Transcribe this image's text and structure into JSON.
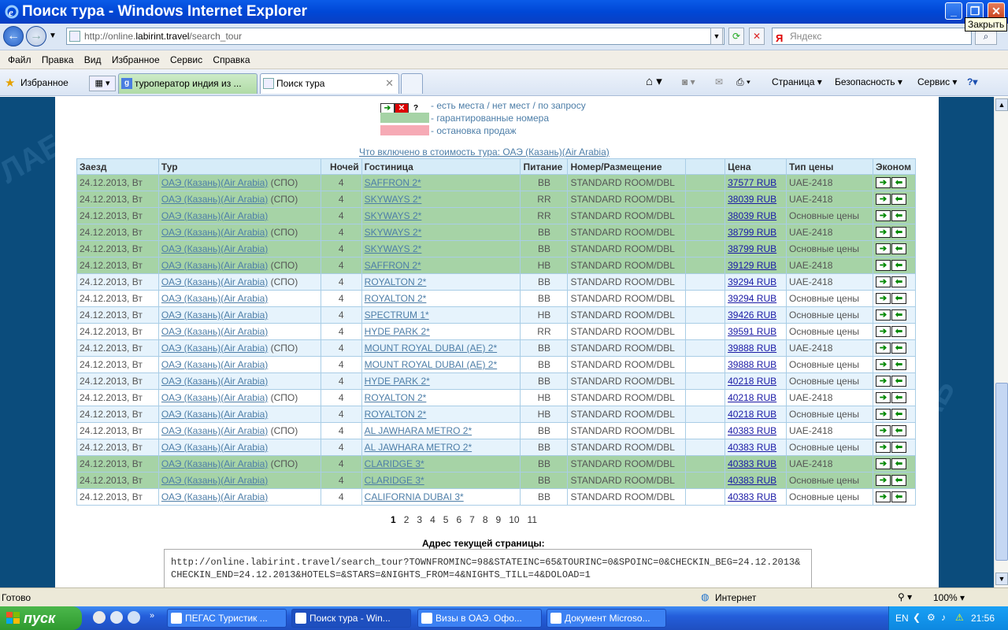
{
  "window": {
    "title": "Поиск тура - Windows Internet Explorer",
    "close_tooltip": "Закрыть",
    "min_label": "_",
    "max_label": "❐",
    "close_label": "✕"
  },
  "address": {
    "prefix": "http://online.",
    "host": "labirint.travel",
    "path": "/search_tour",
    "search_placeholder": "Яндекс",
    "search_engine_glyph": "Я"
  },
  "menu": [
    "Файл",
    "Правка",
    "Вид",
    "Избранное",
    "Сервис",
    "Справка"
  ],
  "favorites_label": "Избранное",
  "tabs": [
    {
      "label": "туроператор индия из ...",
      "active": false
    },
    {
      "label": "Поиск тура",
      "active": true
    }
  ],
  "toolbar": {
    "page": "Страница ▾",
    "security": "Безопасность ▾",
    "service": "Сервис ▾",
    "help": "?▾"
  },
  "legend": {
    "availability": "- есть места / нет мест / по запросу",
    "guaranteed": "- гарантированные номера",
    "stop_sale": "- остановка продаж"
  },
  "included_link": "Что включено в стоимость тура: ОАЭ (Казань)(Air Arabia)",
  "table": {
    "headers": [
      "Заезд",
      "Тур",
      "Ночей",
      "Гостиница",
      "Питание",
      "Номер/Размещение",
      "",
      "Цена",
      "Тип цены",
      "Эконом"
    ],
    "rows": [
      {
        "style": "green",
        "date": "24.12.2013, Вт",
        "tour": "ОАЭ (Казань)(Air Arabia)",
        "spo": "(СПО)",
        "nights": "4",
        "hotel": "SAFFRON 2*",
        "meal": "BB",
        "room": "STANDARD ROOM/DBL",
        "price": "37577 RUB",
        "price_type": "UAE-2418"
      },
      {
        "style": "green",
        "date": "24.12.2013, Вт",
        "tour": "ОАЭ (Казань)(Air Arabia)",
        "spo": "(СПО)",
        "nights": "4",
        "hotel": "SKYWAYS 2*",
        "meal": "RR",
        "room": "STANDARD ROOM/DBL",
        "price": "38039 RUB",
        "price_type": "UAE-2418"
      },
      {
        "style": "green",
        "date": "24.12.2013, Вт",
        "tour": "ОАЭ (Казань)(Air Arabia)",
        "spo": "",
        "nights": "4",
        "hotel": "SKYWAYS 2*",
        "meal": "RR",
        "room": "STANDARD ROOM/DBL",
        "price": "38039 RUB",
        "price_type": "Основные цены"
      },
      {
        "style": "green",
        "date": "24.12.2013, Вт",
        "tour": "ОАЭ (Казань)(Air Arabia)",
        "spo": "(СПО)",
        "nights": "4",
        "hotel": "SKYWAYS 2*",
        "meal": "BB",
        "room": "STANDARD ROOM/DBL",
        "price": "38799 RUB",
        "price_type": "UAE-2418"
      },
      {
        "style": "green",
        "date": "24.12.2013, Вт",
        "tour": "ОАЭ (Казань)(Air Arabia)",
        "spo": "",
        "nights": "4",
        "hotel": "SKYWAYS 2*",
        "meal": "BB",
        "room": "STANDARD ROOM/DBL",
        "price": "38799 RUB",
        "price_type": "Основные цены"
      },
      {
        "style": "green",
        "date": "24.12.2013, Вт",
        "tour": "ОАЭ (Казань)(Air Arabia)",
        "spo": "(СПО)",
        "nights": "4",
        "hotel": "SAFFRON 2*",
        "meal": "HB",
        "room": "STANDARD ROOM/DBL",
        "price": "39129 RUB",
        "price_type": "UAE-2418"
      },
      {
        "style": "blue",
        "date": "24.12.2013, Вт",
        "tour": "ОАЭ (Казань)(Air Arabia)",
        "spo": "(СПО)",
        "nights": "4",
        "hotel": "ROYALTON 2*",
        "meal": "BB",
        "room": "STANDARD ROOM/DBL",
        "price": "39294 RUB",
        "price_type": "UAE-2418"
      },
      {
        "style": "white",
        "date": "24.12.2013, Вт",
        "tour": "ОАЭ (Казань)(Air Arabia)",
        "spo": "",
        "nights": "4",
        "hotel": "ROYALTON 2*",
        "meal": "BB",
        "room": "STANDARD ROOM/DBL",
        "price": "39294 RUB",
        "price_type": "Основные цены"
      },
      {
        "style": "blue",
        "date": "24.12.2013, Вт",
        "tour": "ОАЭ (Казань)(Air Arabia)",
        "spo": "",
        "nights": "4",
        "hotel": "SPECTRUM 1*",
        "meal": "HB",
        "room": "STANDARD ROOM/DBL",
        "price": "39426 RUB",
        "price_type": "Основные цены"
      },
      {
        "style": "white",
        "date": "24.12.2013, Вт",
        "tour": "ОАЭ (Казань)(Air Arabia)",
        "spo": "",
        "nights": "4",
        "hotel": "HYDE PARK 2*",
        "meal": "RR",
        "room": "STANDARD ROOM/DBL",
        "price": "39591 RUB",
        "price_type": "Основные цены"
      },
      {
        "style": "blue",
        "date": "24.12.2013, Вт",
        "tour": "ОАЭ (Казань)(Air Arabia)",
        "spo": "(СПО)",
        "nights": "4",
        "hotel": "MOUNT ROYAL DUBAI (AE) 2*",
        "meal": "BB",
        "room": "STANDARD ROOM/DBL",
        "price": "39888 RUB",
        "price_type": "UAE-2418"
      },
      {
        "style": "white",
        "date": "24.12.2013, Вт",
        "tour": "ОАЭ (Казань)(Air Arabia)",
        "spo": "",
        "nights": "4",
        "hotel": "MOUNT ROYAL DUBAI (AE) 2*",
        "meal": "BB",
        "room": "STANDARD ROOM/DBL",
        "price": "39888 RUB",
        "price_type": "Основные цены"
      },
      {
        "style": "blue",
        "date": "24.12.2013, Вт",
        "tour": "ОАЭ (Казань)(Air Arabia)",
        "spo": "",
        "nights": "4",
        "hotel": "HYDE PARK 2*",
        "meal": "BB",
        "room": "STANDARD ROOM/DBL",
        "price": "40218 RUB",
        "price_type": "Основные цены"
      },
      {
        "style": "white",
        "date": "24.12.2013, Вт",
        "tour": "ОАЭ (Казань)(Air Arabia)",
        "spo": "(СПО)",
        "nights": "4",
        "hotel": "ROYALTON 2*",
        "meal": "HB",
        "room": "STANDARD ROOM/DBL",
        "price": "40218 RUB",
        "price_type": "UAE-2418"
      },
      {
        "style": "blue",
        "date": "24.12.2013, Вт",
        "tour": "ОАЭ (Казань)(Air Arabia)",
        "spo": "",
        "nights": "4",
        "hotel": "ROYALTON 2*",
        "meal": "HB",
        "room": "STANDARD ROOM/DBL",
        "price": "40218 RUB",
        "price_type": "Основные цены"
      },
      {
        "style": "white",
        "date": "24.12.2013, Вт",
        "tour": "ОАЭ (Казань)(Air Arabia)",
        "spo": "(СПО)",
        "nights": "4",
        "hotel": "AL JAWHARA METRO 2*",
        "meal": "BB",
        "room": "STANDARD ROOM/DBL",
        "price": "40383 RUB",
        "price_type": "UAE-2418"
      },
      {
        "style": "blue",
        "date": "24.12.2013, Вт",
        "tour": "ОАЭ (Казань)(Air Arabia)",
        "spo": "",
        "nights": "4",
        "hotel": "AL JAWHARA METRO 2*",
        "meal": "BB",
        "room": "STANDARD ROOM/DBL",
        "price": "40383 RUB",
        "price_type": "Основные цены"
      },
      {
        "style": "green",
        "date": "24.12.2013, Вт",
        "tour": "ОАЭ (Казань)(Air Arabia)",
        "spo": "(СПО)",
        "nights": "4",
        "hotel": "CLARIDGE 3*",
        "meal": "BB",
        "room": "STANDARD ROOM/DBL",
        "price": "40383 RUB",
        "price_type": "UAE-2418"
      },
      {
        "style": "green",
        "date": "24.12.2013, Вт",
        "tour": "ОАЭ (Казань)(Air Arabia)",
        "spo": "",
        "nights": "4",
        "hotel": "CLARIDGE 3*",
        "meal": "BB",
        "room": "STANDARD ROOM/DBL",
        "price": "40383 RUB",
        "price_type": "Основные цены"
      },
      {
        "style": "white",
        "date": "24.12.2013, Вт",
        "tour": "ОАЭ (Казань)(Air Arabia)",
        "spo": "",
        "nights": "4",
        "hotel": "CALIFORNIA DUBAI 3*",
        "meal": "BB",
        "room": "STANDARD ROOM/DBL",
        "price": "40383 RUB",
        "price_type": "Основные цены"
      }
    ]
  },
  "pager": {
    "current": "1",
    "pages": [
      "1",
      "2",
      "3",
      "4",
      "5",
      "6",
      "7",
      "8",
      "9",
      "10",
      "11"
    ]
  },
  "current_address_label": "Адрес текущей страницы:",
  "current_address": "http://online.labirint.travel/search_tour?TOWNFROMINC=98&STATEINC=65&TOURINC=0&SPOINC=0&CHECKIN_BEG=24.12.2013&CHECKIN_END=24.12.2013&HOTELS=&STARS=&NIGHTS_FROM=4&NIGHTS_TILL=4&DOLOAD=1",
  "status": {
    "text": "Готово",
    "zone": "Интернет",
    "zoom": "100% ▾"
  },
  "taskbar": {
    "start": "пуск",
    "tasks": [
      {
        "label": "ПЕГАС Туристик ...",
        "active": false
      },
      {
        "label": "Поиск тура - Win...",
        "active": true
      },
      {
        "label": "Визы в ОАЭ. Офо...",
        "active": false
      },
      {
        "label": "Документ Microso...",
        "active": false
      }
    ],
    "lang": "EN",
    "clock": "21:56"
  },
  "colors": {
    "green_row": "#a6d3a6",
    "blue_row": "#e6f3fc",
    "page_bg": "#0b4c7c",
    "stop_sale": "#f6aab5"
  }
}
